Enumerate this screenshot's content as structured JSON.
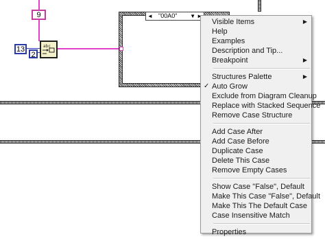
{
  "diagram": {
    "const_top": "9",
    "const_left_1": "13",
    "const_left_2": "2",
    "case_selector": {
      "value": "\"00A0\"",
      "left_arrow": "◄",
      "dropdown": "▼",
      "right_arrow": "►"
    }
  },
  "context_menu": {
    "groups": [
      [
        {
          "label": "Visible Items",
          "submenu": true
        },
        {
          "label": "Help"
        },
        {
          "label": "Examples"
        },
        {
          "label": "Description and Tip..."
        },
        {
          "label": "Breakpoint",
          "submenu": true
        }
      ],
      [
        {
          "label": "Structures Palette",
          "submenu": true
        },
        {
          "label": "Auto Grow",
          "checked": true
        },
        {
          "label": "Exclude from Diagram Cleanup"
        },
        {
          "label": "Replace with Stacked Sequence"
        },
        {
          "label": "Remove Case Structure"
        }
      ],
      [
        {
          "label": "Add Case After"
        },
        {
          "label": "Add Case Before"
        },
        {
          "label": "Duplicate Case"
        },
        {
          "label": "Delete This Case"
        },
        {
          "label": "Remove Empty Cases"
        }
      ],
      [
        {
          "label": "Show Case \"False\", Default"
        },
        {
          "label": "Make This Case \"False\", Default"
        },
        {
          "label": "Make This The Default Case"
        },
        {
          "label": "Case Insensitive Match"
        }
      ],
      [
        {
          "label": "Properties"
        }
      ]
    ],
    "check_glyph": "✓",
    "submenu_glyph": "▶"
  },
  "colors": {
    "wire_pink": "#e040c8",
    "wire_blue": "#2f3fbf",
    "menu_bg": "#f0f0f0"
  }
}
